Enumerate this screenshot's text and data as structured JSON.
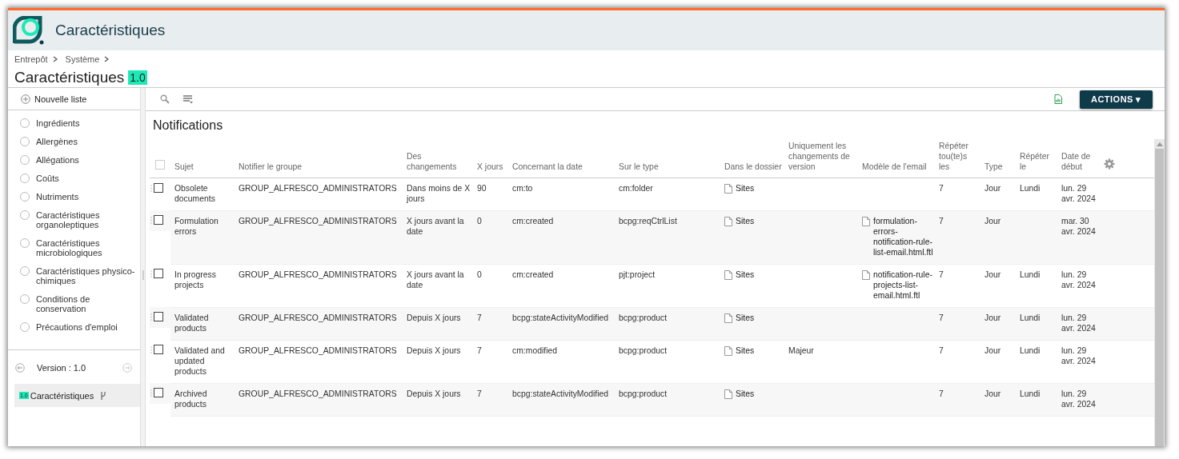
{
  "header": {
    "title": "Caractéristiques"
  },
  "breadcrumb": [
    "Entrepôt",
    "Système"
  ],
  "page": {
    "title": "Caractéristiques",
    "version": "1.0"
  },
  "sidebar": {
    "new_list": "Nouvelle liste",
    "items": [
      {
        "label": "Ingrédients",
        "selected": false
      },
      {
        "label": "Allergènes",
        "selected": false
      },
      {
        "label": "Allégations",
        "selected": false
      },
      {
        "label": "Coûts",
        "selected": false
      },
      {
        "label": "Nutriments",
        "selected": false
      },
      {
        "label": "Caractéristiques organoleptiques",
        "selected": false
      },
      {
        "label": "Caractéristiques microbiologiques",
        "selected": false
      },
      {
        "label": "Caractéristiques physico-chimiques",
        "selected": false
      },
      {
        "label": "Conditions de conservation",
        "selected": false
      },
      {
        "label": "Précautions d'emploi",
        "selected": false
      }
    ],
    "version": "Version : 1.0",
    "version_entry": {
      "version": "1.0",
      "label": "Caractéristiques"
    }
  },
  "toolbar": {
    "actions": "ACTIONS ▾"
  },
  "section_title": "Notifications",
  "table": {
    "select_all": {
      "checked": false
    },
    "columns": [
      {
        "label": "Sujet",
        "kind": "text"
      },
      {
        "label": "Notifier le groupe",
        "kind": "text"
      },
      {
        "label": "Des changements",
        "kind": "text"
      },
      {
        "label": "X jours",
        "kind": "text"
      },
      {
        "label": "Concernant la date",
        "kind": "text"
      },
      {
        "label": "Sur le type",
        "kind": "text"
      },
      {
        "label": "Dans le dossier",
        "kind": "file"
      },
      {
        "label": "Uniquement les changements de version",
        "kind": "text"
      },
      {
        "label": "Modèle de l'email",
        "kind": "file"
      },
      {
        "label": "Répéter tou(te)s les",
        "kind": "text"
      },
      {
        "label": "Type",
        "kind": "text"
      },
      {
        "label": "Répéter le",
        "kind": "text"
      },
      {
        "label": "Date de début",
        "kind": "text"
      }
    ],
    "rows": [
      {
        "checked": false,
        "cells": [
          "Obsolete documents",
          "GROUP_ALFRESCO_ADMINISTRATORS",
          "Dans moins de X jours",
          "90",
          "cm:to",
          "cm:folder",
          "Sites",
          null,
          null,
          "7",
          "Jour",
          "Lundi",
          "lun. 29 avr. 2024"
        ]
      },
      {
        "checked": false,
        "cells": [
          "Formulation errors",
          "GROUP_ALFRESCO_ADMINISTRATORS",
          "X jours avant la date",
          "0",
          "cm:created",
          "bcpg:reqCtrlList",
          "Sites",
          null,
          "formulation-errors-notification-rule-list-email.html.ftl",
          "7",
          "Jour",
          null,
          "mar. 30 avr. 2024"
        ]
      },
      {
        "checked": false,
        "cells": [
          "In progress projects",
          "GROUP_ALFRESCO_ADMINISTRATORS",
          "X jours avant la date",
          "0",
          "cm:created",
          "pjt:project",
          "Sites",
          null,
          "notification-rule-projects-list-email.html.ftl",
          "7",
          "Jour",
          "Lundi",
          "lun. 29 avr. 2024"
        ]
      },
      {
        "checked": false,
        "cells": [
          "Validated products",
          "GROUP_ALFRESCO_ADMINISTRATORS",
          "Depuis X jours",
          "7",
          "bcpg:stateActivityModified",
          "bcpg:product",
          "Sites",
          null,
          null,
          "7",
          "Jour",
          "Lundi",
          "lun. 29 avr. 2024"
        ]
      },
      {
        "checked": false,
        "cells": [
          "Validated and updated products",
          "GROUP_ALFRESCO_ADMINISTRATORS",
          "Depuis X jours",
          "7",
          "cm:modified",
          "bcpg:product",
          "Sites",
          "Majeur",
          null,
          "7",
          "Jour",
          "Lundi",
          "lun. 29 avr. 2024"
        ]
      },
      {
        "checked": false,
        "cells": [
          "Archived products",
          "GROUP_ALFRESCO_ADMINISTRATORS",
          "Depuis X jours",
          "7",
          "bcpg:stateActivityModified",
          "bcpg:product",
          "Sites",
          null,
          null,
          "7",
          "Jour",
          "Lundi",
          "lun. 29 avr. 2024"
        ]
      }
    ]
  }
}
